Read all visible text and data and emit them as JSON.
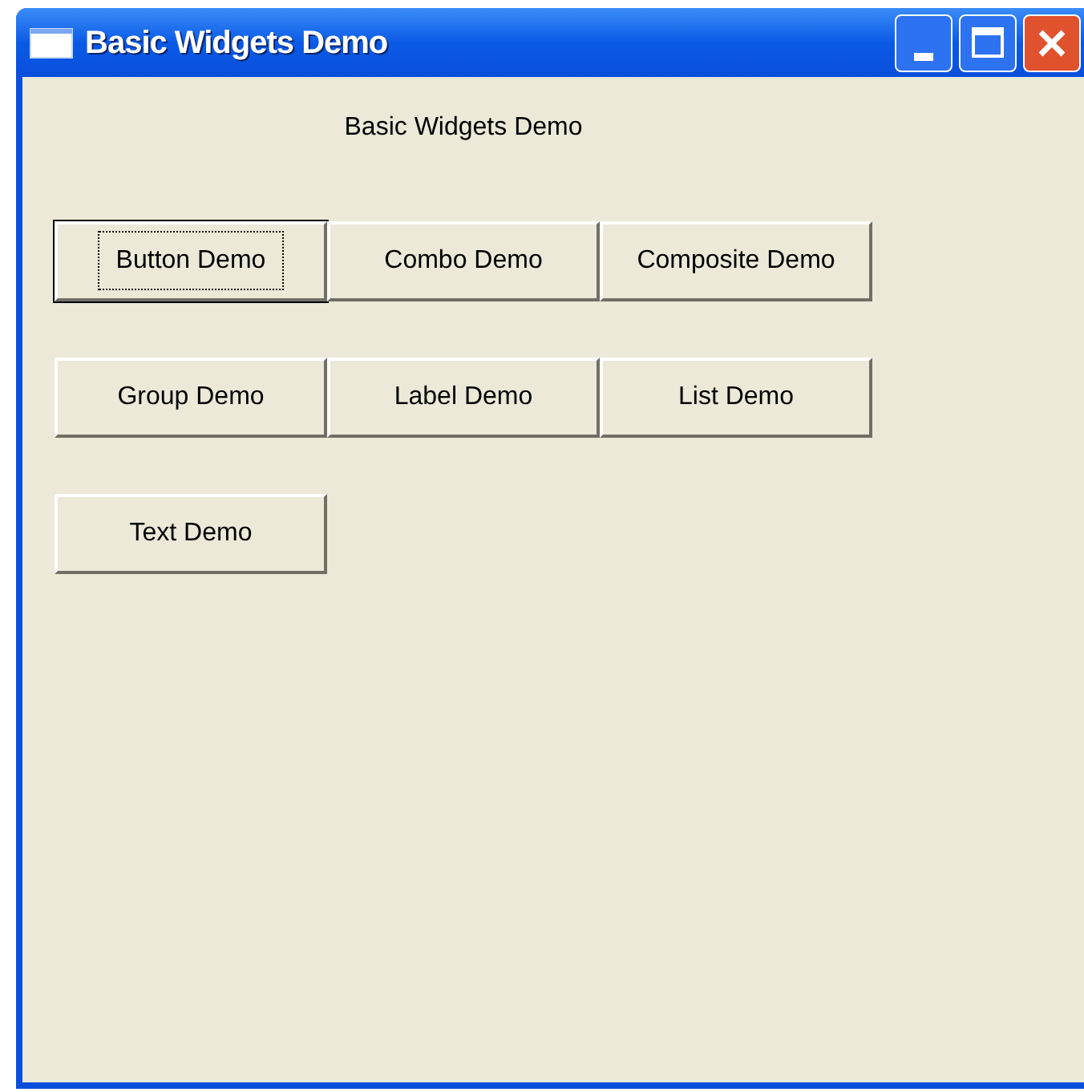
{
  "window": {
    "title": "Basic Widgets Demo"
  },
  "heading": "Basic Widgets Demo",
  "buttons": [
    {
      "label": "Button Demo",
      "focused": true
    },
    {
      "label": "Combo Demo",
      "focused": false
    },
    {
      "label": "Composite Demo",
      "focused": false
    },
    {
      "label": "Group Demo",
      "focused": false
    },
    {
      "label": "Label Demo",
      "focused": false
    },
    {
      "label": "List Demo",
      "focused": false
    },
    {
      "label": "Text Demo",
      "focused": false
    }
  ]
}
